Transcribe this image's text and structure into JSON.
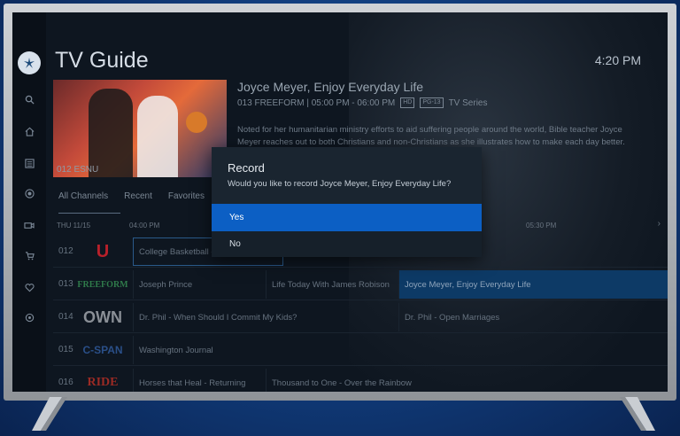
{
  "header": {
    "title": "TV Guide",
    "clock": "4:20 PM"
  },
  "preview": {
    "channel_label": "012 ESNU",
    "program_title": "Joyce Meyer, Enjoy Everyday Life",
    "meta_channel_time": "013 FREEFORM  |  05:00 PM - 06:00 PM",
    "badge_hd": "HD",
    "badge_rating": "PG-13",
    "genre": "TV Series",
    "description": "Noted for her humanitarian ministry efforts to aid suffering people around the world, Bible teacher Joyce Meyer reaches out to both Christians and non-Christians as she illustrates how to make each day better."
  },
  "tabs": [
    "All Channels",
    "Recent",
    "Favorites"
  ],
  "timebar": {
    "date": "THU 11/15",
    "t1": "04:00 PM",
    "t2": "05:30 PM"
  },
  "rows": [
    {
      "num": "012",
      "logo": "U",
      "cells": [
        "College Basketball -"
      ]
    },
    {
      "num": "013",
      "logo": "FREEFORM",
      "cells": [
        "Joseph Prince",
        "Life Today With James Robison",
        "Joyce Meyer, Enjoy Everyday Life"
      ]
    },
    {
      "num": "014",
      "logo": "OWN",
      "cells": [
        "Dr. Phil - When Should I Commit My Kids?",
        "Dr. Phil - Open Marriages"
      ]
    },
    {
      "num": "015",
      "logo": "C-SPAN",
      "cells": [
        "Washington Journal"
      ]
    },
    {
      "num": "016",
      "logo": "RIDE",
      "cells": [
        "Horses that Heal - Returning",
        "Thousand to One - Over the Rainbow"
      ]
    }
  ],
  "dialog": {
    "title": "Record",
    "message": "Would you like to record Joyce Meyer, Enjoy Everyday Life?",
    "yes_label": "Yes",
    "no_label": "No"
  },
  "colors": {
    "accent": "#0c5fc4",
    "highlight": "#0d3a66"
  }
}
